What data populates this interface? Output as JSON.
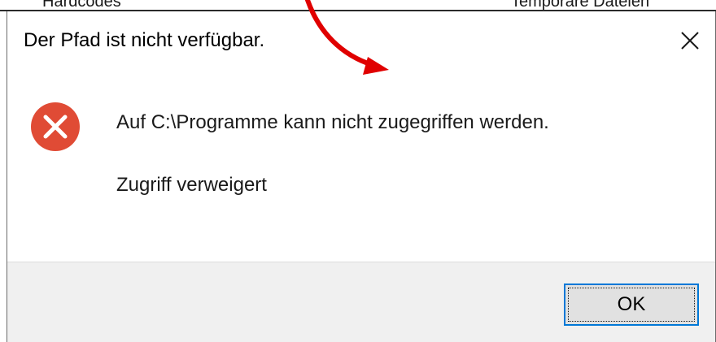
{
  "background_window": {
    "left_text": "Hardcodes",
    "right_text": "Temporäre Dateien"
  },
  "dialog": {
    "title": "Der Pfad ist nicht verfügbar.",
    "close_glyph": "✕",
    "message": "Auf C:\\Programme kann nicht zugegriffen werden.",
    "detail": "Zugriff verweigert",
    "ok_label": "OK",
    "error_icon": "error-x-icon"
  },
  "colors": {
    "error_red": "#e04b35",
    "button_accent": "#0078d7",
    "footer_bg": "#f0f0f0",
    "annotation_arrow": "#e00000"
  }
}
